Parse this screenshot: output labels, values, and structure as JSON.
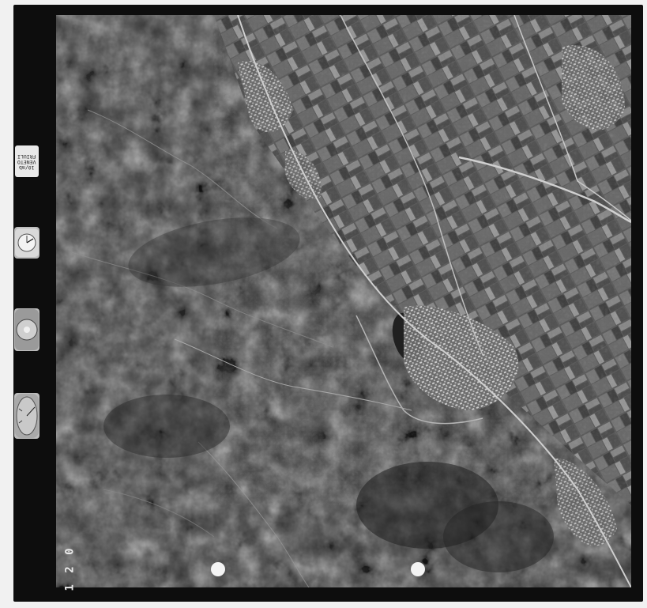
{
  "margin": {
    "label_lines": "10/mb\nVENETO\nFRIULI",
    "film_frame_number": "1 2 0"
  },
  "photo": {
    "kind": "aerial photograph",
    "tone": "black-and-white"
  },
  "instruments": {
    "altimeter": "altimeter-dial-icon",
    "level": "bubble-level-icon",
    "clock": "clock-dial-icon"
  }
}
